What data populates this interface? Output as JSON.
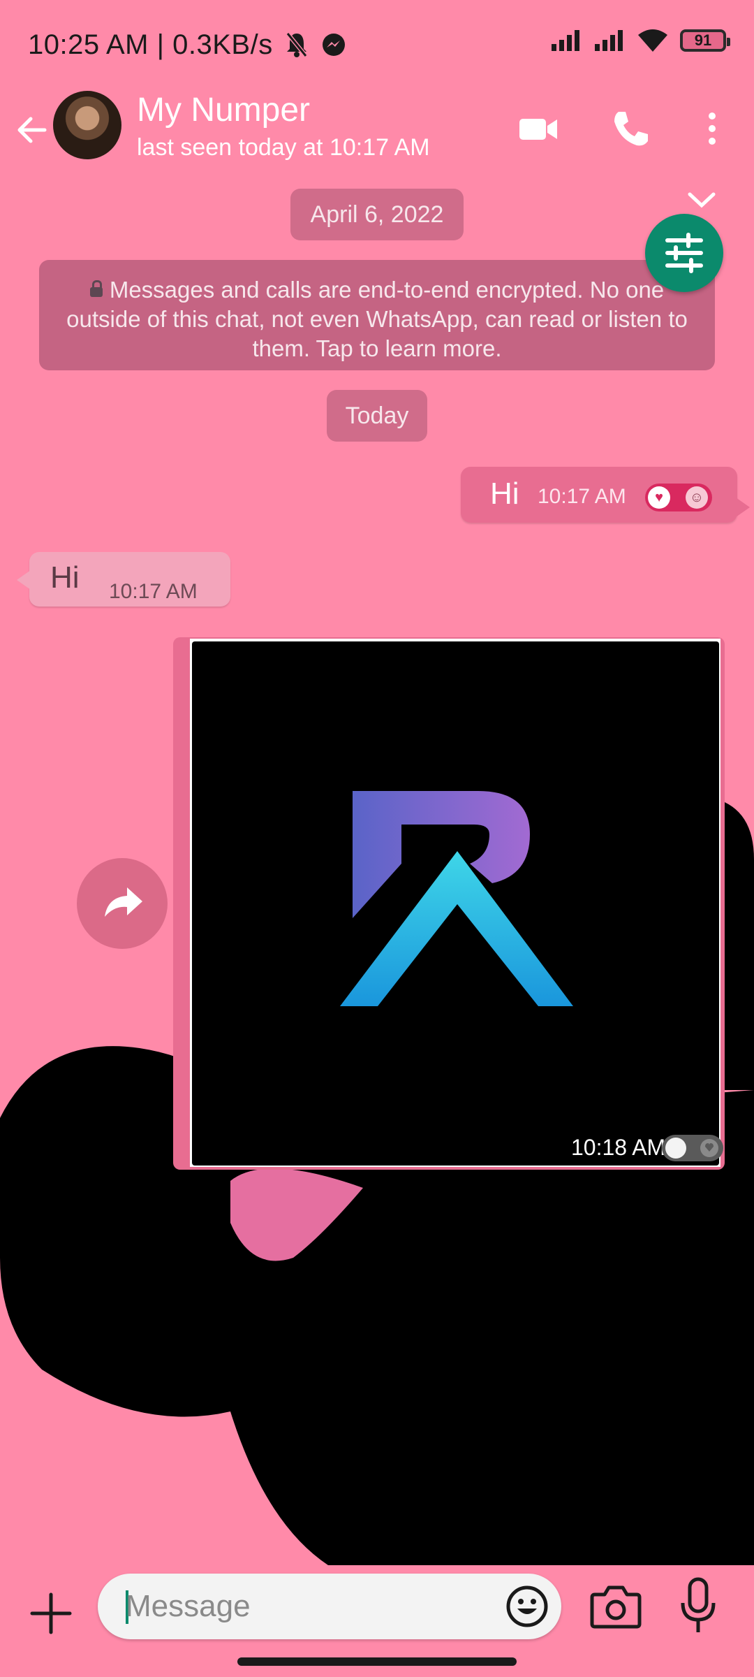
{
  "status_bar": {
    "time": "10:25 AM | 0.3KB/s",
    "battery": "91"
  },
  "header": {
    "contact_name": "My Numper",
    "last_seen": "last seen today at 10:17 AM",
    "icons": [
      "back-arrow-icon",
      "avatar",
      "video-call-icon",
      "phone-icon",
      "more-vert-icon"
    ]
  },
  "chat": {
    "date_separator": "April 6, 2022",
    "encryption_notice": "Messages and calls are end-to-end encrypted. No one outside of this chat, not even WhatsApp, can read or listen to them. Tap to learn more.",
    "today_separator": "Today",
    "messages": [
      {
        "direction": "outgoing",
        "text": "Hi",
        "time": "10:17 AM"
      },
      {
        "direction": "incoming",
        "text": "Hi",
        "time": "10:17 AM"
      },
      {
        "direction": "outgoing",
        "type": "image",
        "time": "10:18 AM"
      }
    ]
  },
  "input": {
    "placeholder": "Message"
  },
  "colors": {
    "background": "#ff8aa9",
    "outgoing_bubble": "#e86d91",
    "incoming_bubble": "#f3a5bb",
    "accent": "#0b8a6c"
  }
}
